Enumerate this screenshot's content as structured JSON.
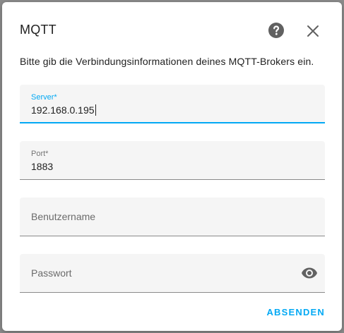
{
  "dialog": {
    "title": "MQTT",
    "description": "Bitte gib die Verbindungsinformationen deines MQTT-Brokers ein.",
    "submit_label": "ABSENDEN"
  },
  "fields": {
    "server": {
      "label": "Server*",
      "value": "192.168.0.195"
    },
    "port": {
      "label": "Port*",
      "value": "1883"
    },
    "username": {
      "placeholder": "Benutzername",
      "value": ""
    },
    "password": {
      "placeholder": "Passwort",
      "value": ""
    }
  },
  "icons": {
    "help": "help-circle-icon",
    "close": "close-icon",
    "visibility": "eye-icon"
  },
  "colors": {
    "accent": "#03a9f4",
    "text": "#212121",
    "field_bg": "#f5f5f5"
  }
}
